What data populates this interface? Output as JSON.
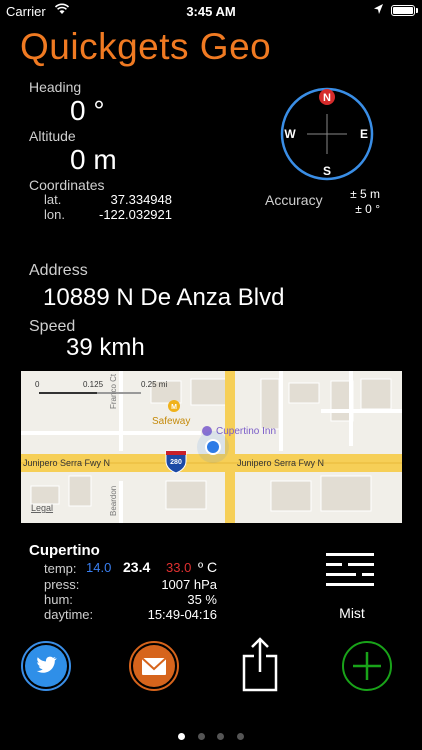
{
  "status_bar": {
    "carrier": "Carrier",
    "time": "3:45 AM"
  },
  "app": {
    "title": "Quickgets Geo"
  },
  "heading": {
    "label": "Heading",
    "value": "0 °"
  },
  "altitude": {
    "label": "Altitude",
    "value": "0 m"
  },
  "coordinates": {
    "label": "Coordinates",
    "lat_label": "lat.",
    "lat": "37.334948",
    "lon_label": "lon.",
    "lon": "-122.032921"
  },
  "compass": {
    "north": "N",
    "east": "E",
    "south": "S",
    "west": "W",
    "heading_deg": 0
  },
  "accuracy": {
    "label": "Accuracy",
    "distance": "± 5 m",
    "angle": "± 0 °"
  },
  "address": {
    "label": "Address",
    "value": "10889 N De Anza Blvd"
  },
  "speed": {
    "label": "Speed",
    "value": "39 kmh"
  },
  "map": {
    "scale_0": "0",
    "scale_1": "0.125",
    "scale_2": "0.25 mi",
    "road_main": "Junipero Serra Fwy N",
    "road_main_2": "Junipero Serra Fwy N",
    "shield": "280",
    "poi_1": "Safeway",
    "poi_2": "Cupertino Inn",
    "street_1": "Franco Ct",
    "street_2": "Beardon",
    "legal": "Legal"
  },
  "weather": {
    "city": "Cupertino",
    "temp_label": "temp:",
    "temp_low": "14.0",
    "temp_current": "23.4",
    "temp_high": "33.0",
    "temp_unit": "º C",
    "press_label": "press:",
    "pressure": "1007 hPa",
    "hum_label": "hum:",
    "humidity": "35 %",
    "daytime_label": "daytime:",
    "daytime": "15:49-04:16",
    "condition": "Mist"
  },
  "actions": {
    "twitter_icon": "twitter-bird-icon",
    "mail_icon": "envelope-icon",
    "share_icon": "share-icon",
    "add_icon": "plus-icon"
  },
  "pagination": {
    "pages": 4,
    "current": 1
  },
  "colors": {
    "title": "#f07a22",
    "compass_ring": "#3a8ee6",
    "north_badge": "#d62b2b",
    "temp_low": "#3a7ff0",
    "temp_high": "#e03030",
    "twitter": "#3a8ee6",
    "mail": "#d6641c",
    "add": "#19a319"
  }
}
